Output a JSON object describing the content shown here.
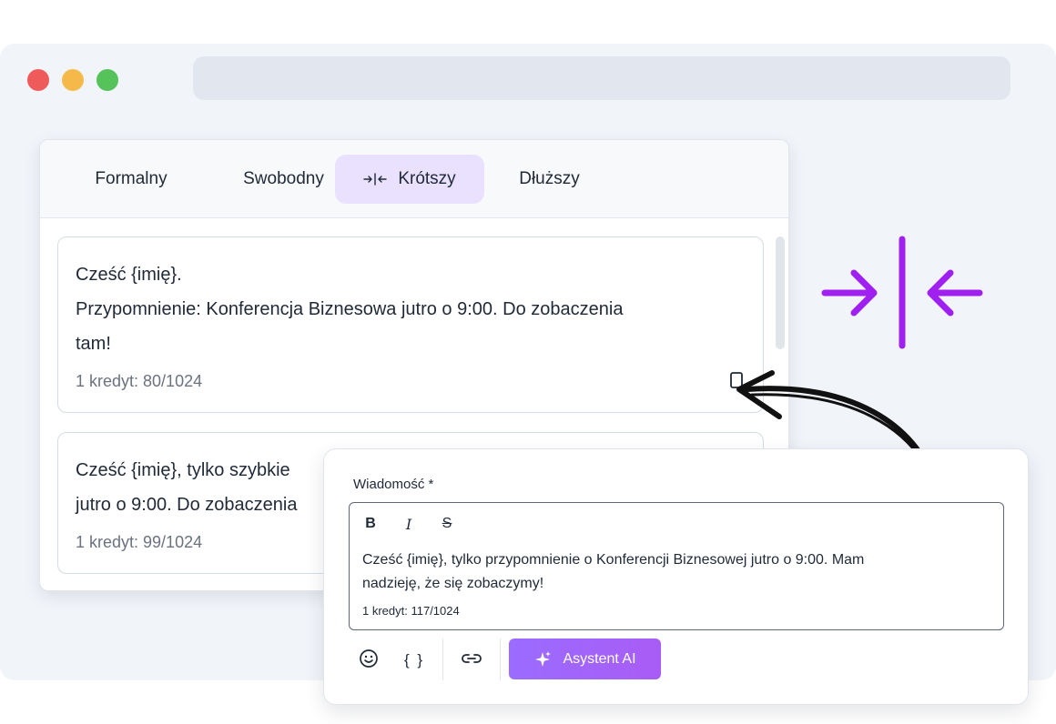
{
  "window": {
    "controls": {
      "close_color": "#ef5b5b",
      "minimize_color": "#f5b94a",
      "maximize_color": "#56c25a"
    }
  },
  "tabs": [
    {
      "label": "Formalny",
      "active": false
    },
    {
      "label": "Swobodny",
      "active": false
    },
    {
      "label": "Krótszy",
      "active": true,
      "icon": "compress-icon"
    },
    {
      "label": "Dłuższy",
      "active": false
    }
  ],
  "cards": [
    {
      "lines": [
        "Cześć {imię}.",
        "Przypomnienie: Konferencja Biznesowa jutro o 9:00. Do zobaczenia",
        "tam!"
      ],
      "credit": "1 kredyt: 80/1024",
      "action_icon": "copy-icon"
    },
    {
      "lines": [
        "Cześć {imię}, tylko szybkie",
        "jutro o 9:00. Do zobaczenia"
      ],
      "credit": "1 kredyt: 99/1024"
    }
  ],
  "editor": {
    "label": "Wiadomość *",
    "format_buttons": {
      "bold": "B",
      "italic": "I",
      "strike": "S"
    },
    "lines": [
      "Cześć {imię}, tylko przypomnienie o Konferencji Biznesowej jutro o 9:00. Mam",
      "nadzieję, że się zobaczymy!"
    ],
    "credit": "1 kredyt: 117/1024",
    "tools": {
      "emoji_icon": "smiley-icon",
      "variables_label": "{ }",
      "link_icon": "link-icon"
    },
    "ai_button": {
      "label": "Asystent AI",
      "icon": "sparkle-icon"
    }
  },
  "colors": {
    "accent": "#a020f0",
    "active_tab_bg": "#e9e1ff",
    "ai_button": "#9b6cff"
  }
}
